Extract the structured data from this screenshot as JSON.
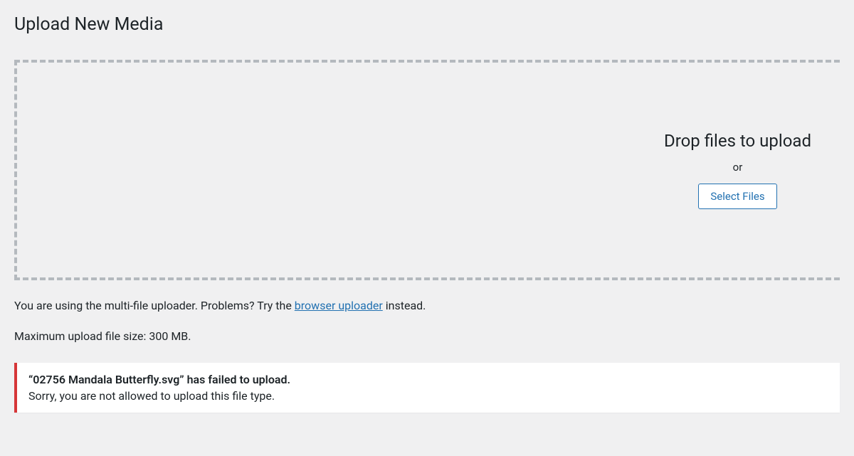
{
  "page": {
    "title": "Upload New Media"
  },
  "dropzone": {
    "heading": "Drop files to upload",
    "or": "or",
    "select_button": "Select Files"
  },
  "uploader_info": {
    "prefix": "You are using the multi-file uploader. Problems? Try the ",
    "link_text": "browser uploader",
    "suffix": " instead."
  },
  "max_size": "Maximum upload file size: 300 MB.",
  "error": {
    "title": "“02756 Mandala Butterfly.svg” has failed to upload.",
    "message": "Sorry, you are not allowed to upload this file type."
  }
}
